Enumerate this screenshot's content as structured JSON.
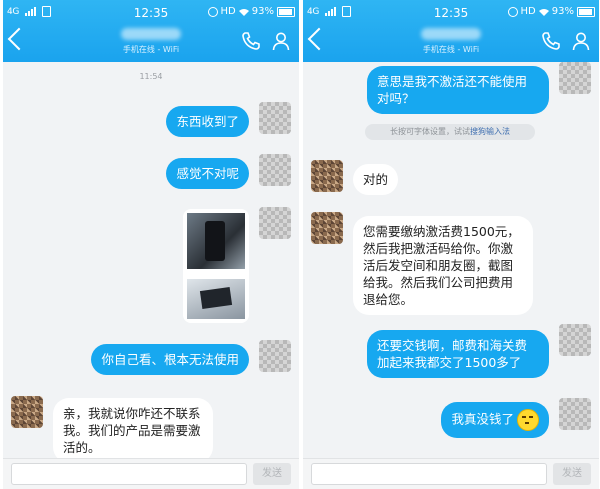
{
  "status": {
    "network": "4G",
    "time": "12:35",
    "hd": "HD",
    "battery": "93%"
  },
  "header": {
    "subtitle": "手机在线 - WiFi"
  },
  "left_chat": {
    "timestamp": "11:54",
    "messages": [
      {
        "side": "right",
        "text": "东西收到了"
      },
      {
        "side": "right",
        "text": "感觉不对呢"
      },
      {
        "side": "right",
        "text": "你自己看、根本无法使用"
      },
      {
        "side": "left",
        "text": "亲，我就说你咋还不联系我。我们的产品是需要激活的。"
      }
    ]
  },
  "right_chat": {
    "messages": [
      {
        "side": "right",
        "text": "意思是我不激活还不能使用对吗？"
      },
      {
        "side": "left",
        "text": "对的"
      },
      {
        "side": "left",
        "text": "您需要缴纳激活费1500元，然后我把激活码给你。你激活后发空间和朋友圈，截图给我。然后我们公司把费用退给您。"
      },
      {
        "side": "right",
        "text": "还要交钱啊，邮费和海关费加起来我都交了1500多了"
      },
      {
        "side": "right",
        "text": "我真没钱了"
      }
    ],
    "hint_prefix": "长按可字体设置，试试",
    "hint_link": "搜狗输入法"
  },
  "input": {
    "send_label": "发送"
  },
  "colors": {
    "header": "#1aa3ee",
    "bubble_blue": "#17a8f0",
    "chat_bg": "#f1f3f5"
  }
}
